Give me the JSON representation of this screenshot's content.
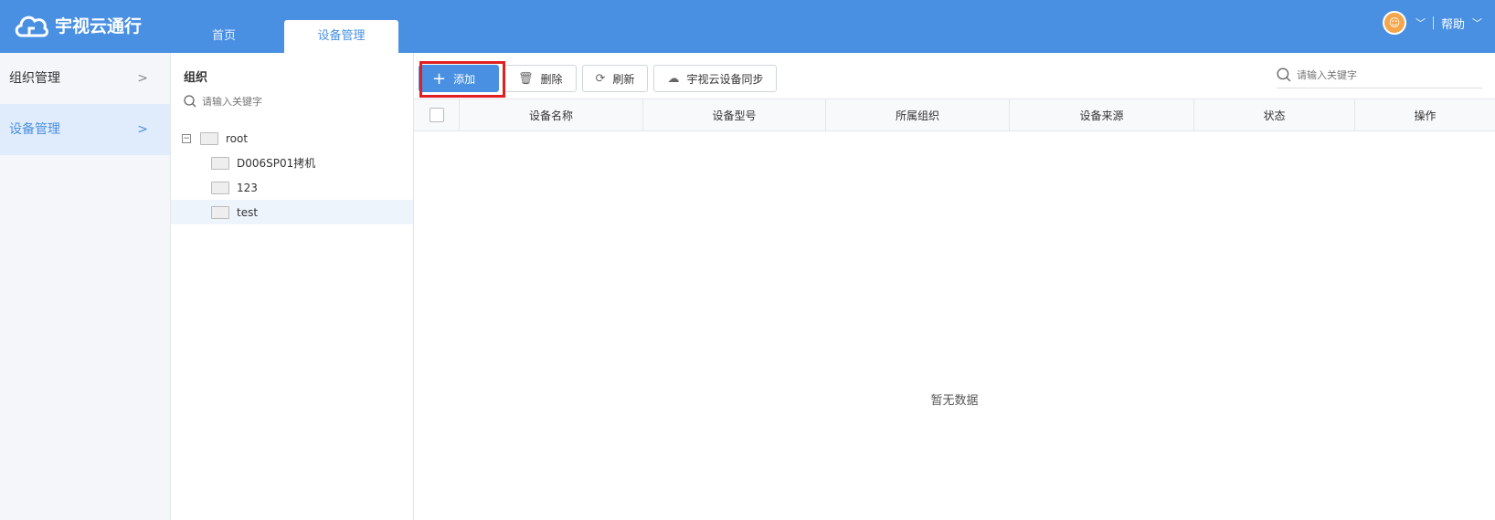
{
  "app": {
    "title": "宇视云通行"
  },
  "nav_tabs": [
    {
      "label": "首页"
    },
    {
      "label": "设备管理"
    }
  ],
  "header": {
    "help_label": "帮助"
  },
  "left_nav": [
    {
      "label": "组织管理"
    },
    {
      "label": "设备管理"
    }
  ],
  "org_panel": {
    "title": "组织",
    "search_placeholder": "请输入关键字",
    "tree": {
      "root": "root",
      "children": [
        "D006SP01拷机",
        "123",
        "test"
      ]
    }
  },
  "toolbar": {
    "add_label": "添加",
    "delete_label": "删除",
    "refresh_label": "刷新",
    "sync_label": "宇视云设备同步"
  },
  "main_search": {
    "placeholder": "请输入关键字"
  },
  "table": {
    "columns": [
      "设备名称",
      "设备型号",
      "所属组织",
      "设备来源",
      "状态",
      "操作"
    ],
    "empty_text": "暂无数据"
  },
  "colors": {
    "brand": "#4a90e2",
    "highlight": "#e02020"
  }
}
